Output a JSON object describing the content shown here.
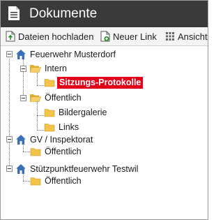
{
  "window": {
    "title": "Dokumente",
    "icon": "document-icon"
  },
  "toolbar": {
    "upload_label": "Dateien hochladen",
    "new_link_label": "Neuer Link",
    "view_label": "Ansicht",
    "upload_icon": "upload-file-icon",
    "new_link_icon": "new-link-icon",
    "view_icon": "grid-view-icon"
  },
  "colors": {
    "titlebar": "#3a3a3a",
    "selection": "#e2001a",
    "folder": "#f2c449",
    "home": "#3b6fb6"
  },
  "tree": {
    "root1": {
      "label": "Feuerwehr Musterdorf",
      "intern": {
        "label": "Intern",
        "child": {
          "label": "Sitzungs-Protokolle",
          "selected": true
        }
      },
      "oeffentlich": {
        "label": "Öffentlich",
        "children": [
          {
            "label": "Bildergalerie"
          },
          {
            "label": "Links"
          }
        ]
      }
    },
    "root2": {
      "label": "GV / Inspektorat",
      "child": {
        "label": "Öffentlich"
      }
    },
    "root3": {
      "label": "Stützpunktfeuerwehr Testwil",
      "child": {
        "label": "Öffentlich"
      }
    }
  }
}
